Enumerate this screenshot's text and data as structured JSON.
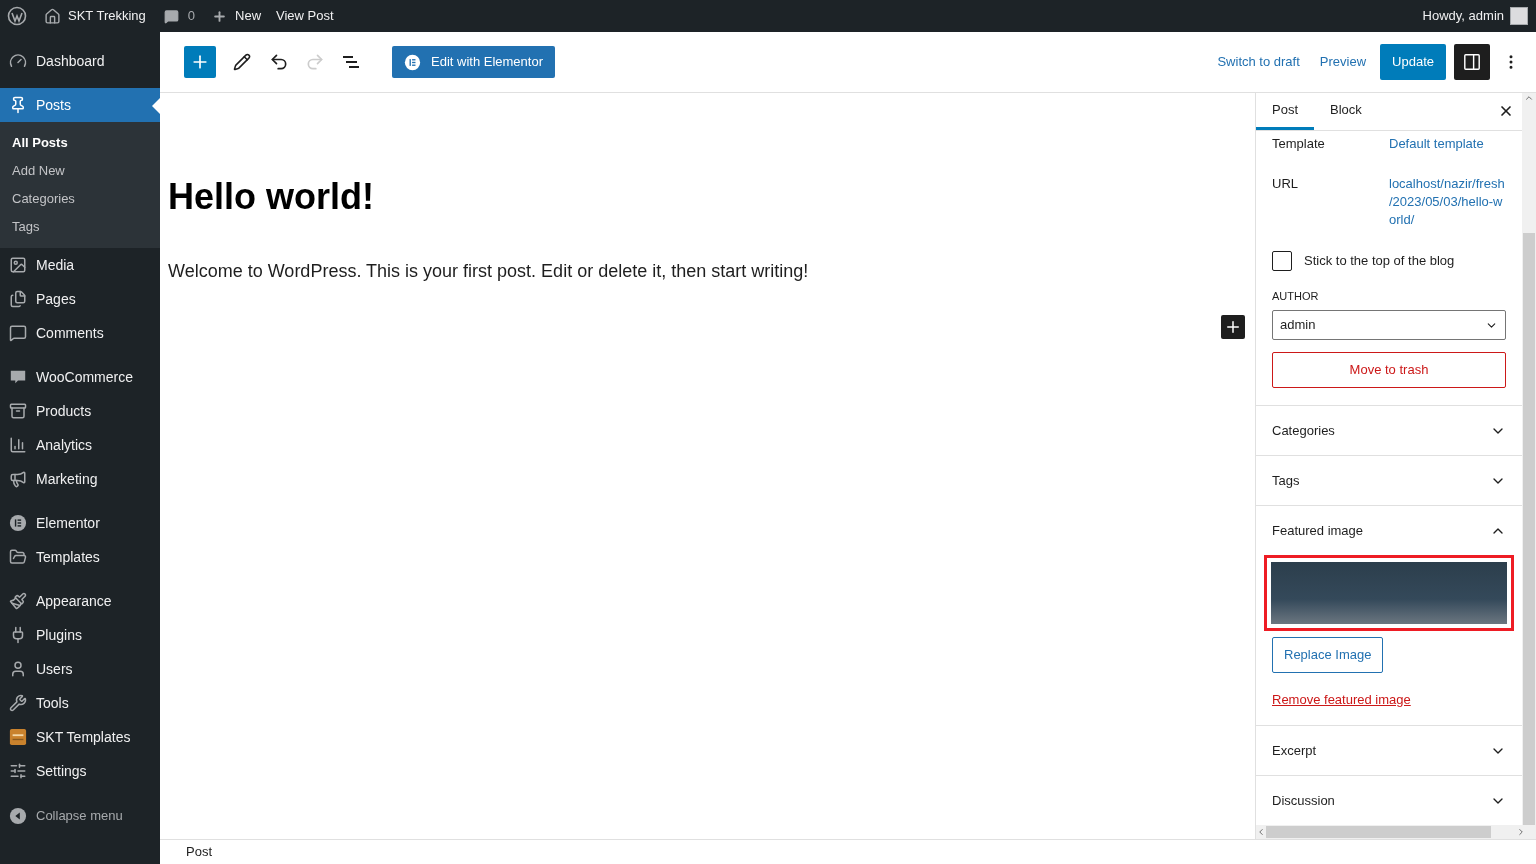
{
  "admin_bar": {
    "site_name": "SKT Trekking",
    "comment_count": "0",
    "new_label": "New",
    "view_label": "View Post",
    "greeting": "Howdy, admin"
  },
  "sidebar": {
    "groups": [
      [
        {
          "label": "Dashboard",
          "selected": false
        }
      ],
      [
        {
          "label": "Posts",
          "selected": true,
          "children": [
            {
              "label": "All Posts",
              "selected": true
            },
            {
              "label": "Add New",
              "selected": false
            },
            {
              "label": "Categories",
              "selected": false
            },
            {
              "label": "Tags",
              "selected": false
            }
          ]
        },
        {
          "label": "Media",
          "selected": false
        },
        {
          "label": "Pages",
          "selected": false
        },
        {
          "label": "Comments",
          "selected": false
        }
      ],
      [
        {
          "label": "WooCommerce",
          "selected": false
        },
        {
          "label": "Products",
          "selected": false
        },
        {
          "label": "Analytics",
          "selected": false
        },
        {
          "label": "Marketing",
          "selected": false
        }
      ],
      [
        {
          "label": "Elementor",
          "selected": false
        },
        {
          "label": "Templates",
          "selected": false
        }
      ],
      [
        {
          "label": "Appearance",
          "selected": false
        },
        {
          "label": "Plugins",
          "selected": false
        },
        {
          "label": "Users",
          "selected": false
        },
        {
          "label": "Tools",
          "selected": false
        },
        {
          "label": "SKT Templates",
          "selected": false
        },
        {
          "label": "Settings",
          "selected": false
        }
      ]
    ],
    "collapse_label": "Collapse menu"
  },
  "toolbar": {
    "undo": {
      "disabled": false
    },
    "redo": {
      "disabled": true
    },
    "elementor_label": "Edit with Elementor",
    "switch_to_draft": "Switch to draft",
    "preview": "Preview",
    "update": "Update",
    "settings_toggle": {
      "pressed": true
    }
  },
  "editor": {
    "title": "Hello world!",
    "paragraph": "Welcome to WordPress. This is your first post. Edit or delete it, then start writing!"
  },
  "settings_panel": {
    "tabs": [
      {
        "label": "Post",
        "selected": true
      },
      {
        "label": "Block",
        "selected": false
      }
    ],
    "fields": [
      {
        "label": "Template",
        "value": "Default template"
      },
      {
        "label": "URL",
        "value": "localhost/nazir/fresh /2023/05/03/hello-world/"
      }
    ],
    "sticky": {
      "label": "Stick to the top of the blog",
      "checked": false
    },
    "author": {
      "label": "AUTHOR",
      "value": "admin"
    },
    "trash_label": "Move to trash",
    "sections": [
      {
        "title": "Categories",
        "expanded": false
      },
      {
        "title": "Tags",
        "expanded": false
      },
      {
        "title": "Featured image",
        "expanded": true,
        "replace_label": "Replace Image",
        "remove_label": "Remove featured image"
      },
      {
        "title": "Excerpt",
        "expanded": false
      },
      {
        "title": "Discussion",
        "expanded": false
      }
    ]
  },
  "footer": {
    "breadcrumb": "Post"
  }
}
